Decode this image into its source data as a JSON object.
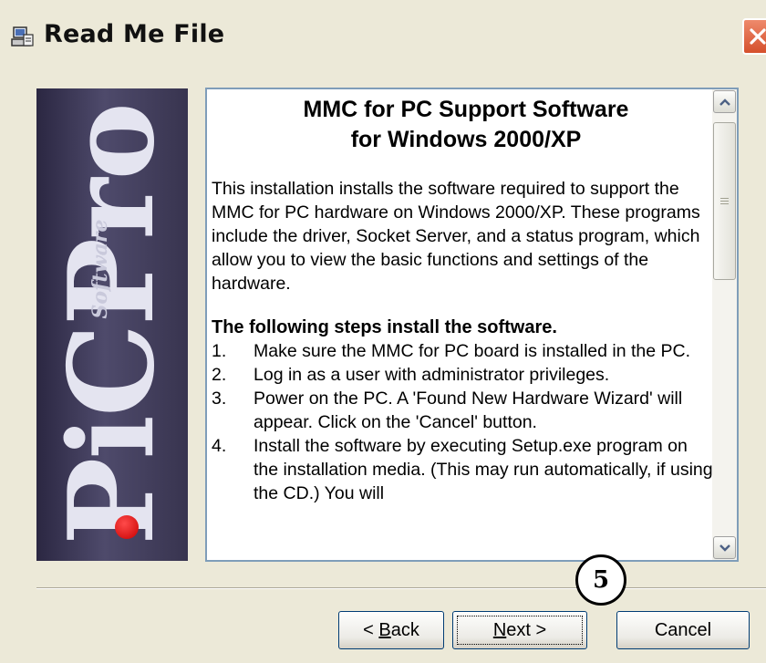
{
  "window": {
    "title": "Read Me File",
    "icon": "setup-computer-icon",
    "close_icon": "close-icon"
  },
  "logo": {
    "word": "PiCPro",
    "tagline": "Software",
    "dot_color": "#d40000"
  },
  "readme": {
    "title_line1": "MMC for PC Support Software",
    "title_line2": "for Windows 2000/XP",
    "intro": "This installation installs the software required to support the MMC for PC hardware on Windows 2000/XP. These programs include the driver, Socket Server, and a status program, which allow you to view the basic functions and settings of the hardware.",
    "steps_heading": "The following steps install the software.",
    "steps": [
      {
        "num": "1.",
        "text": "Make sure the MMC for PC board is installed in the PC."
      },
      {
        "num": "2.",
        "text": "Log in as a user with administrator privileges."
      },
      {
        "num": "3.",
        "text": "Power on the PC. A 'Found New Hardware Wizard' will appear. Click on the 'Cancel' button."
      },
      {
        "num": "4.",
        "text": "Install the software by executing Setup.exe program on the installation media. (This may run automatically, if using the CD.) You will"
      }
    ]
  },
  "scrollbar": {
    "up_icon": "scroll-up-arrow-icon",
    "down_icon": "scroll-down-arrow-icon"
  },
  "buttons": {
    "back_pre": "< ",
    "back_u": "B",
    "back_post": "ack",
    "next_u": "N",
    "next_post": "ext >",
    "cancel": "Cancel"
  },
  "annotation": {
    "step_number": "5"
  },
  "colors": {
    "window_bg": "#ece9d8",
    "close_button": "#d5502c",
    "textbox_border": "#7f9db9",
    "logo_bg": "#3d3957"
  }
}
